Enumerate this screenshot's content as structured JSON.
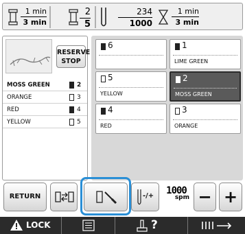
{
  "status": {
    "stitch_time_label": "1 min",
    "total_time_label": "3 min",
    "color_step_current": "2",
    "color_step_total": "5",
    "stitch_count_current": "234",
    "stitch_count_total": "1000",
    "time_remaining_label": "1 min",
    "time_total_label": "3 min"
  },
  "left_panel": {
    "reserve_stop_line1": "RESERVE",
    "reserve_stop_line2": "STOP",
    "colors": [
      {
        "name": "MOSS GREEN",
        "needle": "2",
        "selected": true,
        "filled": true
      },
      {
        "name": "ORANGE",
        "needle": "3",
        "selected": false,
        "filled": false
      },
      {
        "name": "RED",
        "needle": "4",
        "selected": false,
        "filled": true
      },
      {
        "name": "YELLOW",
        "needle": "5",
        "selected": false,
        "filled": false
      }
    ]
  },
  "needle_grid": [
    {
      "needle": "6",
      "name": "",
      "filled": true,
      "active": false
    },
    {
      "needle": "1",
      "name": "LIME GREEN",
      "filled": true,
      "active": false
    },
    {
      "needle": "5",
      "name": "YELLOW",
      "filled": false,
      "active": false
    },
    {
      "needle": "2",
      "name": "MOSS GREEN",
      "filled": true,
      "active": true
    },
    {
      "needle": "4",
      "name": "RED",
      "filled": true,
      "active": false
    },
    {
      "needle": "3",
      "name": "ORANGE",
      "filled": false,
      "active": false
    }
  ],
  "toolbar": {
    "return_label": "RETURN",
    "speed_value": "1000",
    "speed_unit": "spm",
    "minus_label": "−",
    "plus_label": "+",
    "needle_adjust_label": "-/+"
  },
  "nav": {
    "lock_label": "LOCK",
    "help_label": "?"
  },
  "colors": {
    "highlight": "#2a8fd6",
    "active_cell": "#5a5a5a",
    "nav_bg": "#2b2b2b"
  },
  "icons": [
    "spool-icon",
    "needle-icon",
    "hourglass-icon",
    "thread-trim-icon",
    "color-swap-icon",
    "needle-bar-icon",
    "warning-lock-icon",
    "list-icon",
    "machine-help-icon",
    "frame-move-icon"
  ]
}
